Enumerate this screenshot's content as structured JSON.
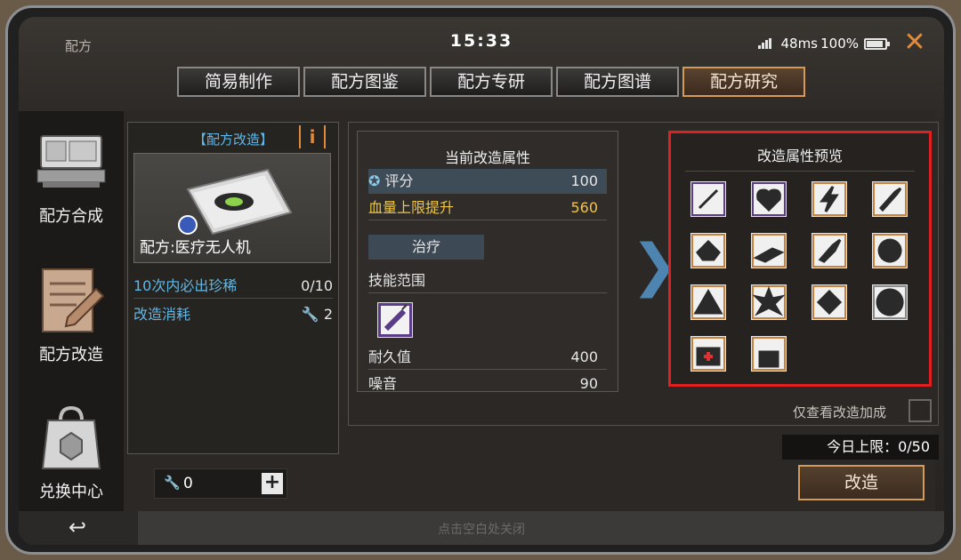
{
  "status_bar": {
    "app_title": "配方",
    "time": "15:33",
    "ping": "48ms",
    "battery": "100%"
  },
  "tabs": [
    {
      "label": "简易制作",
      "active": false
    },
    {
      "label": "配方图鉴",
      "active": false
    },
    {
      "label": "配方专研",
      "active": false
    },
    {
      "label": "配方图谱",
      "active": false
    },
    {
      "label": "配方研究",
      "active": true
    }
  ],
  "sidebar": {
    "items": [
      {
        "label": "配方合成",
        "icon": "terminal-icon"
      },
      {
        "label": "配方改造",
        "icon": "notepad-pencil-icon"
      },
      {
        "label": "兑换中心",
        "icon": "shopping-bag-icon"
      }
    ]
  },
  "recipe": {
    "header": "【配方改造】",
    "info_mark": "i",
    "name": "配方:医疗无人机",
    "guarantee_label": "10次内必出珍稀",
    "guarantee_value": "0/10",
    "cost_label": "改造消耗",
    "cost_value": "2"
  },
  "stepper": {
    "count": "0",
    "plus": "+"
  },
  "current_attrs": {
    "title": "当前改造属性",
    "rows": [
      {
        "label": "评分",
        "value": "100"
      },
      {
        "label": "血量上限提升",
        "value": "560"
      }
    ],
    "heal_badge": "治疗",
    "skill_range_label": "技能范围",
    "durability_label": "耐久值",
    "durability_value": "400",
    "noise_label": "噪音",
    "noise_value": "90"
  },
  "preview": {
    "title": "改造属性预览",
    "icons": [
      "syringe-icon",
      "heart-icon",
      "lightning-icon",
      "bullet-icon",
      "armor-up-icon",
      "speed-up-icon",
      "rocket-up-icon",
      "timer-up-icon",
      "tent-up-icon",
      "explosion-up-icon",
      "burst-up-icon",
      "target-icon",
      "medkit-icon",
      "lock-icon"
    ]
  },
  "only_modified_label": "仅查看改造加成",
  "daily_limit": "今日上限：0/50",
  "modify_button": "改造",
  "tap_close": "点击空白处关闭",
  "colors": {
    "accent_orange": "#e08a3a",
    "link_blue": "#5fb6e8",
    "gold": "#f2c640",
    "highlight_red": "#e02020"
  }
}
